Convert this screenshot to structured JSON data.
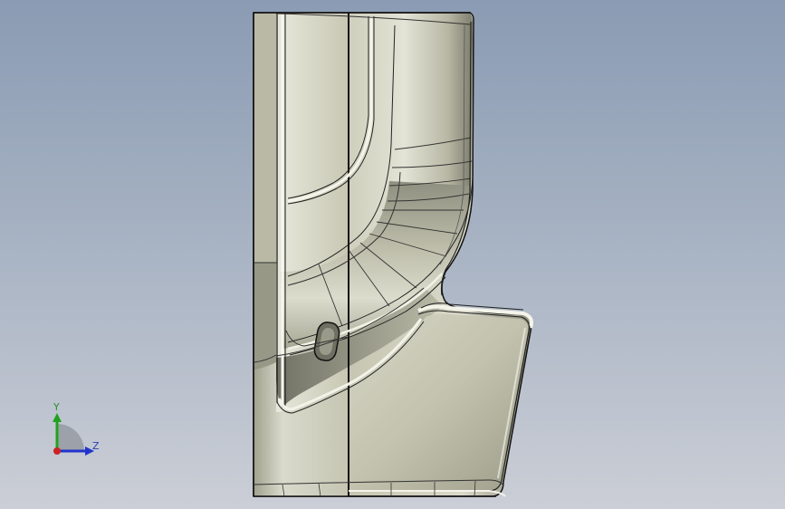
{
  "triad": {
    "y_label": "Y",
    "z_label": "Z",
    "colors": {
      "y_axis": "#1fa31f",
      "z_axis": "#2233cc",
      "x_axis": "#cc2222"
    }
  },
  "model": {
    "icon": "cad-part-side-view"
  },
  "colors": {
    "background_top": "#8a9bb3",
    "background_bottom": "#cbced6",
    "part_body": "#c9c9b4",
    "part_highlight": "#ecece0",
    "part_shadow": "#6f6f62",
    "edge": "#111111"
  }
}
